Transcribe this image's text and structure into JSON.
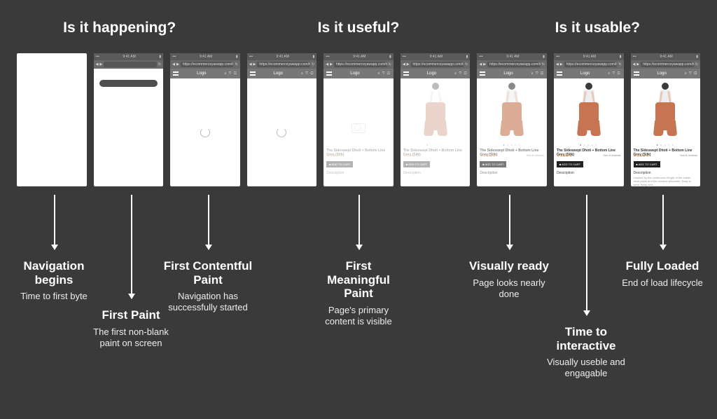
{
  "questions": {
    "q1": "Is it happening?",
    "q2": "Is it useful?",
    "q3": "Is it usable?"
  },
  "chrome": {
    "time": "9:41 AM",
    "url": "https://ecommerceyawapp.com/buy-wi",
    "logo": "Logo",
    "topbar_icons": "⌕ ♡ ▢"
  },
  "product": {
    "title": "The Sideswept Dhoti + Bottom Line Grey (Silk)",
    "stars": "★★★★★",
    "reviews_link": "See 8 reviews",
    "add_btn": "■ ADD TO CART",
    "desc_header": "Description",
    "desc_body": "Inspired by the continuous length of the Indian dhoti pants and the modern silhouette. Easy to wear, flowy and..."
  },
  "stages": {
    "s1": {
      "title": "Navigation begins",
      "sub": "Time to first byte"
    },
    "s2": {
      "title": "First Paint",
      "sub": "The first non-blank paint on screen"
    },
    "s3": {
      "title": "First Contentful Paint",
      "sub": "Navigation has successfully started"
    },
    "s4": {
      "title": "First Meaningful Paint",
      "sub": "Page's primary content is visible"
    },
    "s5": {
      "title": "Visually ready",
      "sub": "Page looks nearly done"
    },
    "s6": {
      "title": "Time to interactive",
      "sub": "Visually useble and engagable"
    },
    "s7": {
      "title": "Fully Loaded",
      "sub": "End of load lifecycle"
    }
  }
}
